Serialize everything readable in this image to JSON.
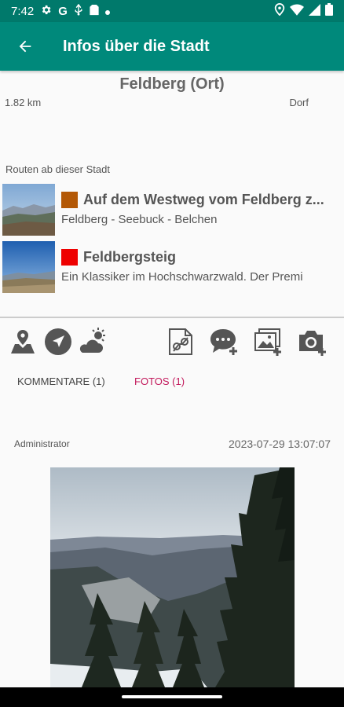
{
  "status_bar": {
    "time": "7:42",
    "left_icons": [
      "gear-icon",
      "google-icon",
      "usb-icon",
      "sim-icon",
      "dot-icon"
    ],
    "right_icons": [
      "location-icon",
      "wifi-icon",
      "signal-icon",
      "battery-icon"
    ]
  },
  "app_bar": {
    "title": "Infos über die Stadt"
  },
  "place": {
    "name": "Feldberg (Ort)",
    "distance": "1.82 km",
    "type": "Dorf"
  },
  "routes_label": "Routen ab dieser Stadt",
  "routes": [
    {
      "title": "Auf dem Westweg vom Feldberg z...",
      "description": "Feldberg - Seebuck - Belchen",
      "color": "#b35806"
    },
    {
      "title": "Feldbergsteig",
      "description": "Ein Klassiker im Hochschwarzwald. Der Premi",
      "color": "#ee0000"
    }
  ],
  "actions": [
    "map-pin-icon",
    "navigate-icon",
    "weather-icon",
    "gpx-file-icon",
    "add-comment-icon",
    "add-photo-icon",
    "add-camera-icon"
  ],
  "tabs": [
    {
      "label": "KOMMENTARE (1)",
      "active": false
    },
    {
      "label": "FOTOS (1)",
      "active": true
    }
  ],
  "accent_color": "#c2185b",
  "comment": {
    "user": "Administrator",
    "date": "2023-07-29 13:07:07"
  }
}
